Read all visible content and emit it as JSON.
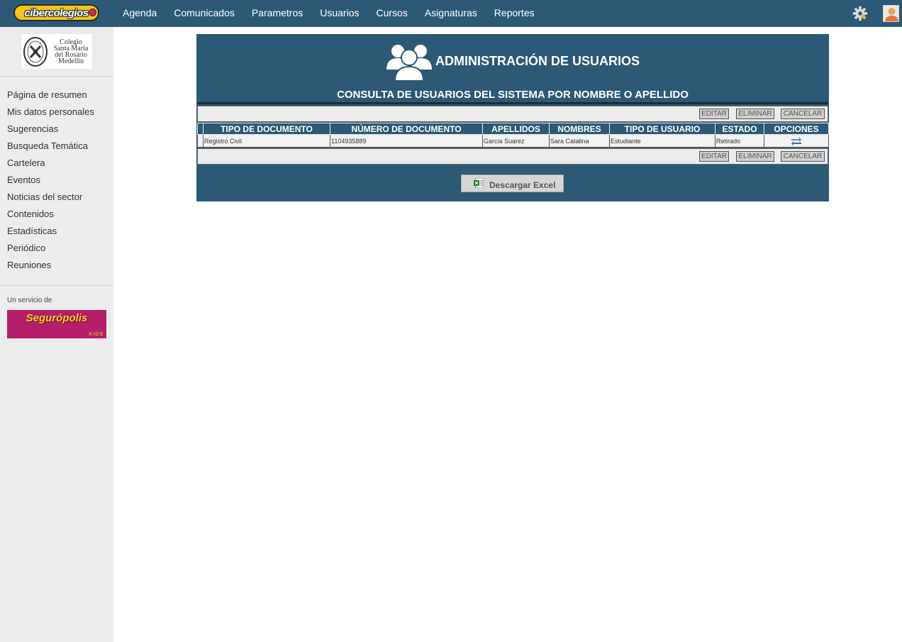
{
  "brand": {
    "logo_text": "cibercolegios"
  },
  "nav": {
    "items": [
      "Agenda",
      "Comunicados",
      "Parametros",
      "Usuarios",
      "Cursos",
      "Asignaturas",
      "Reportes"
    ],
    "settings_icon": "gear-icon",
    "user_icon": "user-avatar-icon"
  },
  "sidebar": {
    "school_logo_text": [
      "Colegio",
      "Santa María",
      "del Rosario",
      "Medellín"
    ],
    "items": [
      "Página de resumen",
      "Mis datos personales",
      "Sugerencias",
      "Busqueda Temática",
      "Cartelera",
      "Eventos",
      "Noticias del sector",
      "Contenidos",
      "Estadísticas",
      "Periódico",
      "Reuniones"
    ],
    "service_label": "Un servicio de",
    "sponsor_text": "Segurópolis",
    "sponsor_sub": "KIDS"
  },
  "panel": {
    "title": "ADMINISTRACIÓN DE USUARIOS",
    "subtitle": "CONSULTA DE USUARIOS DEL SISTEMA POR NOMBRE O APELLIDO",
    "actions": {
      "edit": "EDITAR",
      "delete": "ELIMINAR",
      "cancel": "CANCELAR"
    },
    "table": {
      "headers": [
        "",
        "TIPO DE DOCUMENTO",
        "NÚMERO DE DOCUMENTO",
        "APELLIDOS",
        "NOMBRES",
        "TIPO DE USUARIO",
        "ESTADO",
        "OPCIONES"
      ],
      "rows": [
        [
          "",
          "Registro Civil",
          "1104935889",
          "Garcia Suarez",
          "Sara Catalina",
          "Estudiante",
          "Retirado",
          ""
        ]
      ]
    },
    "download_label": "Descargar Excel"
  },
  "colors": {
    "topbar": "#2c5a76",
    "panel": "#2c5a76",
    "sidebar": "#ececec",
    "logo_yellow": "#f2c516",
    "sponsor_magenta": "#b51f6a"
  }
}
